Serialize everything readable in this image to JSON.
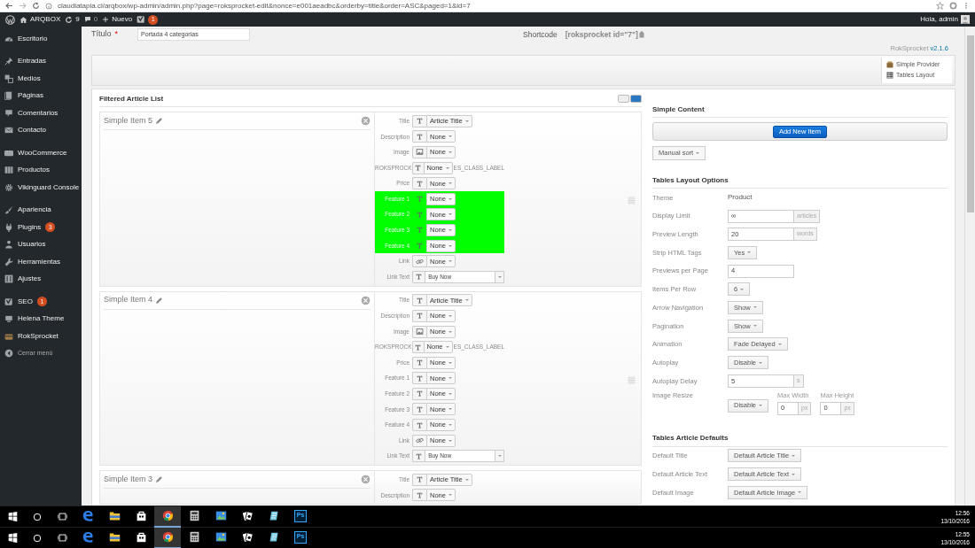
{
  "browser": {
    "url": "claudiatapia.cl/arqbox/wp-admin/admin.php?page=roksprocket-edit&nonce=e001aeadbc&orderby=title&order=ASC&paged=1&id=7"
  },
  "admin_bar": {
    "site": "ARQBOX",
    "updates": "9",
    "comments": "0",
    "new_label": "Nuevo",
    "seo_badge": "1",
    "greeting": "Hola, admin"
  },
  "sidebar": {
    "groups": [
      [
        {
          "label": "Escritorio",
          "selected": false
        }
      ],
      [
        {
          "label": "Entradas",
          "selected": false
        },
        {
          "label": "Medios",
          "selected": false
        },
        {
          "label": "Páginas",
          "selected": false
        },
        {
          "label": "Comentarios",
          "selected": false
        },
        {
          "label": "Contacto",
          "selected": false
        }
      ],
      [
        {
          "label": "WooCommerce",
          "selected": false
        },
        {
          "label": "Productos",
          "selected": false
        },
        {
          "label": "Vikinguard Console",
          "selected": false
        }
      ],
      [
        {
          "label": "Apariencia",
          "selected": false
        },
        {
          "label": "Plugins",
          "badge": "3",
          "selected": false
        },
        {
          "label": "Usuarios",
          "selected": false
        },
        {
          "label": "Herramientas",
          "selected": false
        },
        {
          "label": "Ajustes",
          "selected": false
        }
      ],
      [
        {
          "label": "SEO",
          "badge": "1",
          "selected": false
        },
        {
          "label": "Helena Theme",
          "selected": false
        },
        {
          "label": "RokSprocket",
          "selected": false
        },
        {
          "label": "Cerrar menú",
          "kind": "collapse",
          "selected": false
        }
      ]
    ]
  },
  "header": {
    "title_label": "Título",
    "required_mark": "*",
    "title_value": "Portada 4 categorias",
    "shortcode_label": "Shortcode",
    "shortcode_value": "[roksprocket id=\"7\"]",
    "version_name": "RokSprocket",
    "version": "v2.1.6"
  },
  "provider_box": [
    "Simple Provider",
    "Tables Layout"
  ],
  "article_list": {
    "title": "Filtered Article List",
    "items": [
      {
        "title": "Simple Item 5",
        "fields": [
          {
            "label": "Title",
            "kind": "text",
            "value": "Article Title",
            "highlighted": false
          },
          {
            "label": "Description",
            "kind": "text",
            "value": "None",
            "highlighted": false
          },
          {
            "label": "Image",
            "kind": "image",
            "value": "None",
            "highlighted": false
          },
          {
            "label": "ROKSPROCK",
            "kind": "text",
            "value": "None",
            "suffix": "ES_CLASS_LABEL",
            "highlighted": false
          },
          {
            "label": "Price",
            "kind": "text",
            "value": "None",
            "highlighted": false
          },
          {
            "label": "Feature 1",
            "kind": "text",
            "value": "None",
            "highlighted": true
          },
          {
            "label": "Feature 2",
            "kind": "text",
            "value": "None",
            "highlighted": true
          },
          {
            "label": "Feature 3",
            "kind": "text",
            "value": "None",
            "highlighted": true
          },
          {
            "label": "Feature 4",
            "kind": "text",
            "value": "None",
            "highlighted": true
          },
          {
            "label": "Link",
            "kind": "link",
            "value": "None",
            "highlighted": false
          },
          {
            "label": "Link Text",
            "kind": "wide",
            "value": "Buy Now",
            "highlighted": false
          }
        ]
      },
      {
        "title": "Simple Item 4",
        "fields": [
          {
            "label": "Title",
            "kind": "text",
            "value": "Article Title",
            "highlighted": false
          },
          {
            "label": "Description",
            "kind": "text",
            "value": "None",
            "highlighted": false
          },
          {
            "label": "Image",
            "kind": "image",
            "value": "None",
            "highlighted": false
          },
          {
            "label": "ROKSPROCK",
            "kind": "text",
            "value": "None",
            "suffix": "ES_CLASS_LABEL",
            "highlighted": false
          },
          {
            "label": "Price",
            "kind": "text",
            "value": "None",
            "highlighted": false
          },
          {
            "label": "Feature 1",
            "kind": "text",
            "value": "None",
            "highlighted": false
          },
          {
            "label": "Feature 2",
            "kind": "text",
            "value": "None",
            "highlighted": false
          },
          {
            "label": "Feature 3",
            "kind": "text",
            "value": "None",
            "highlighted": false
          },
          {
            "label": "Feature 4",
            "kind": "text",
            "value": "None",
            "highlighted": false
          },
          {
            "label": "Link",
            "kind": "link",
            "value": "None",
            "highlighted": false
          },
          {
            "label": "Link Text",
            "kind": "wide",
            "value": "Buy Now",
            "highlighted": false
          }
        ]
      },
      {
        "title": "Simple Item 3",
        "fields": [
          {
            "label": "Title",
            "kind": "text",
            "value": "Article Title",
            "highlighted": false
          },
          {
            "label": "Description",
            "kind": "text",
            "value": "None",
            "highlighted": false
          }
        ]
      }
    ]
  },
  "simple_content": {
    "title": "Simple Content",
    "add_button": "Add New Item",
    "sort_button": "Manual sort"
  },
  "layout_options": {
    "title": "Tables Layout Options",
    "rows": [
      {
        "label": "Theme",
        "kind": "text",
        "value": "Product"
      },
      {
        "label": "Display Limit",
        "kind": "input",
        "value": "∞",
        "addon": "articles"
      },
      {
        "label": "Preview Length",
        "kind": "input",
        "value": "20",
        "addon": "words"
      },
      {
        "label": "Strip HTML Tags",
        "kind": "select",
        "value": "Yes"
      },
      {
        "label": "Previews per Page",
        "kind": "input",
        "value": "4"
      },
      {
        "label": "Items Per Row",
        "kind": "select",
        "value": "6"
      },
      {
        "label": "Arrow Navigation",
        "kind": "select",
        "value": "Show"
      },
      {
        "label": "Pagination",
        "kind": "select",
        "value": "Show"
      },
      {
        "label": "Animation",
        "kind": "select",
        "value": "Fade Delayed"
      },
      {
        "label": "Autoplay",
        "kind": "select",
        "value": "Disable"
      },
      {
        "label": "Autoplay Delay",
        "kind": "input",
        "value": "5",
        "addon": "s"
      },
      {
        "label": "Image Resize",
        "kind": "resize",
        "value": "Disable",
        "width_label": "Max Width",
        "width_value": "0",
        "height_label": "Max Height",
        "height_value": "0",
        "width_unit": "px",
        "height_unit": "px"
      }
    ]
  },
  "article_defaults": {
    "title": "Tables Article Defaults",
    "rows": [
      {
        "label": "Default Title",
        "kind": "select",
        "value": "Default Article Title"
      },
      {
        "label": "Default Article Text",
        "kind": "select",
        "value": "Default Article Text"
      },
      {
        "label": "Default Image",
        "kind": "select",
        "value": "Default Article Image"
      }
    ]
  },
  "taskbars": [
    {
      "time": "12:56",
      "date": "13/10/2016",
      "apps": [
        {
          "kind": "edge",
          "selected": false
        },
        {
          "kind": "folder",
          "selected": false
        },
        {
          "kind": "store",
          "selected": false
        },
        {
          "kind": "chrome",
          "selected": true
        },
        {
          "kind": "calculator",
          "selected": false
        },
        {
          "kind": "photo",
          "selected": false
        },
        {
          "kind": "cards",
          "selected": false
        },
        {
          "kind": "notes",
          "selected": false
        },
        {
          "kind": "ps",
          "label": "Ps",
          "selected": false
        }
      ]
    },
    {
      "time": "12:55",
      "date": "13/10/2016",
      "apps": [
        {
          "kind": "edge",
          "selected": false
        },
        {
          "kind": "folder",
          "selected": false
        },
        {
          "kind": "store",
          "selected": false
        },
        {
          "kind": "chrome",
          "selected": true
        },
        {
          "kind": "calculator",
          "selected": false
        },
        {
          "kind": "photo",
          "selected": false
        },
        {
          "kind": "cards",
          "selected": false
        },
        {
          "kind": "notes",
          "selected": false
        },
        {
          "kind": "ps",
          "label": "Ps",
          "selected": false
        }
      ]
    }
  ]
}
